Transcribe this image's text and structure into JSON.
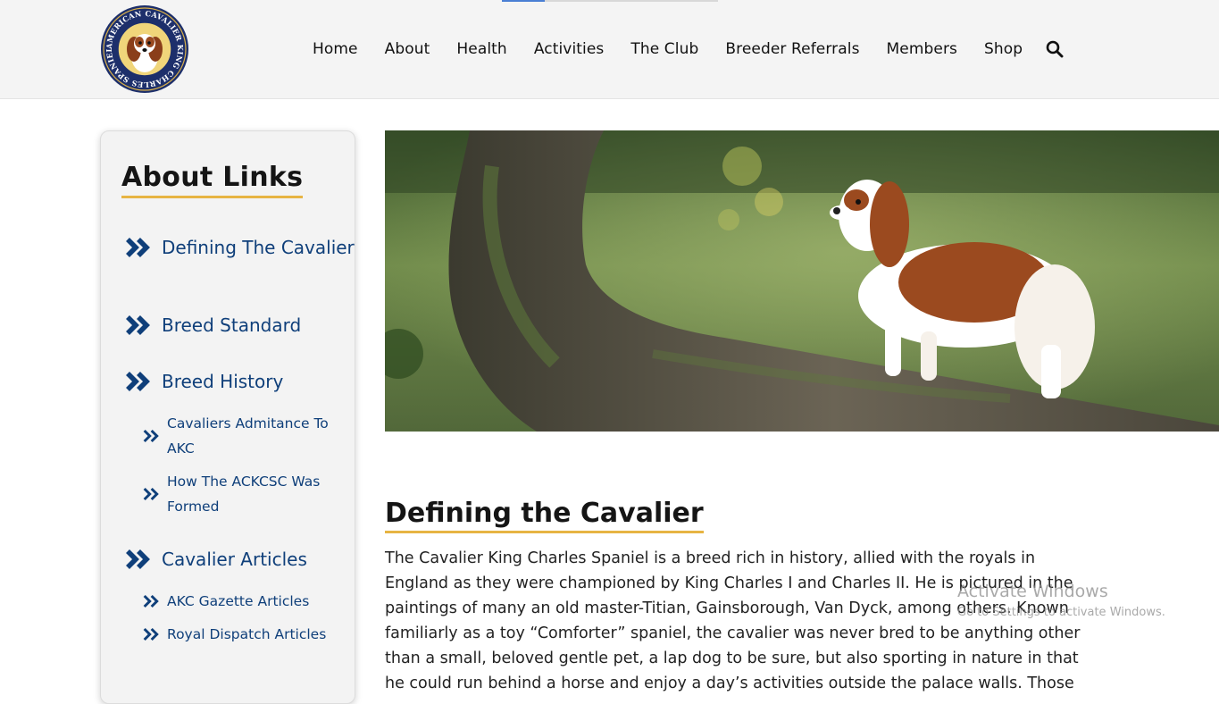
{
  "header": {
    "loading_progress": 0.2,
    "logo_text": "AMERICAN CAVALIER KING CHARLES SPANIEL CLUB",
    "nav": [
      "Home",
      "About",
      "Health",
      "Activities",
      "The Club",
      "Breeder Referrals",
      "Members",
      "Shop"
    ],
    "search_icon": "search-icon"
  },
  "sidebar": {
    "title": "About Links",
    "links": [
      {
        "label": "Defining The Cavalier",
        "level": "main"
      },
      {
        "label": "Breed Standard",
        "level": "main"
      },
      {
        "label": "Breed History",
        "level": "main"
      },
      {
        "label": "Cavaliers Admitance To AKC",
        "level": "sub"
      },
      {
        "label": "How The ACKCSC Was Formed",
        "level": "sub"
      },
      {
        "label": "Cavalier Articles",
        "level": "main"
      },
      {
        "label": "AKC Gazette Articles",
        "level": "sub"
      },
      {
        "label": "Royal Dispatch Articles",
        "level": "sub"
      }
    ],
    "link_icon": "double-chevron-right-icon"
  },
  "article": {
    "title": "Defining the Cavalier",
    "body": "The Cavalier King Charles Spaniel is a breed rich in history, allied with the royals in England as they were championed by King Charles I and Charles II.  He is pictured in the paintings of many an old master-Titian, Gainsborough, Van Dyck, among others. Known familiarly as a toy “Comforter” spaniel, the cavalier was never bred to be anything other than a small, beloved gentle pet, a lap dog to be sure, but also sporting in nature in that he could run behind a horse and enjoy a day’s activities outside the palace walls.  Those"
  },
  "watermark": {
    "title": "Activate Windows",
    "subtitle": "Go to Settings to activate Windows."
  },
  "colors": {
    "link_blue": "#0f3f7a",
    "accent_gold": "#e7b443",
    "header_bg": "#f4f4f4"
  }
}
